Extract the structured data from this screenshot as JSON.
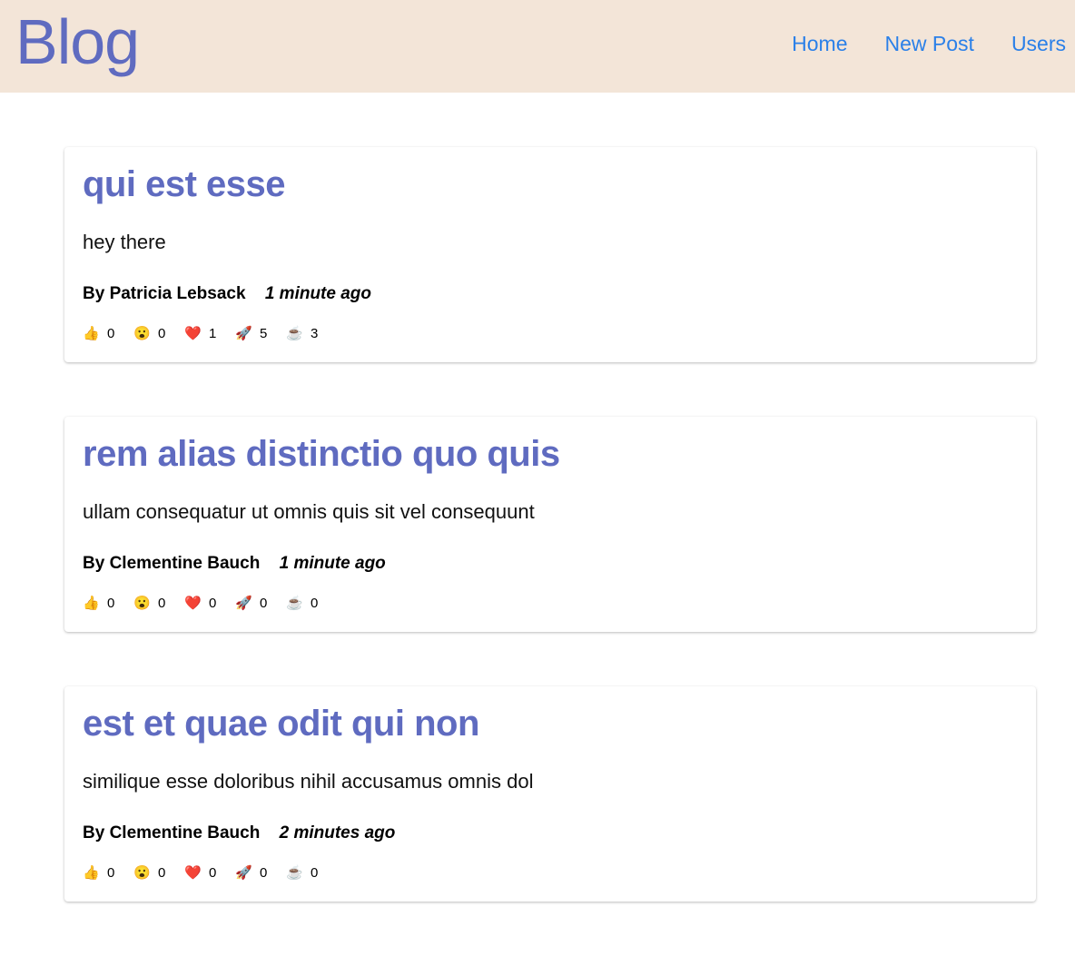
{
  "header": {
    "brand": "Blog",
    "nav": [
      {
        "label": "Home"
      },
      {
        "label": "New Post"
      },
      {
        "label": "Users"
      }
    ]
  },
  "posts": [
    {
      "title": "qui est esse",
      "body": "hey there",
      "author": "By Patricia Lebsack",
      "time": "1 minute ago",
      "reactions": [
        {
          "icon": "👍",
          "name": "thumbs-up-icon",
          "count": "0"
        },
        {
          "icon": "😮",
          "name": "surprised-face-icon",
          "count": "0"
        },
        {
          "icon": "❤️",
          "name": "heart-icon",
          "count": "1"
        },
        {
          "icon": "🚀",
          "name": "rocket-icon",
          "count": "5"
        },
        {
          "icon": "☕",
          "name": "coffee-icon",
          "count": "3"
        }
      ]
    },
    {
      "title": "rem alias distinctio quo quis",
      "body": "ullam consequatur ut omnis quis sit vel consequunt",
      "author": "By Clementine Bauch",
      "time": "1 minute ago",
      "reactions": [
        {
          "icon": "👍",
          "name": "thumbs-up-icon",
          "count": "0"
        },
        {
          "icon": "😮",
          "name": "surprised-face-icon",
          "count": "0"
        },
        {
          "icon": "❤️",
          "name": "heart-icon",
          "count": "0"
        },
        {
          "icon": "🚀",
          "name": "rocket-icon",
          "count": "0"
        },
        {
          "icon": "☕",
          "name": "coffee-icon",
          "count": "0"
        }
      ]
    },
    {
      "title": "est et quae odit qui non",
      "body": "similique esse doloribus nihil accusamus omnis dol",
      "author": "By Clementine Bauch",
      "time": "2 minutes ago",
      "reactions": [
        {
          "icon": "👍",
          "name": "thumbs-up-icon",
          "count": "0"
        },
        {
          "icon": "😮",
          "name": "surprised-face-icon",
          "count": "0"
        },
        {
          "icon": "❤️",
          "name": "heart-icon",
          "count": "0"
        },
        {
          "icon": "🚀",
          "name": "rocket-icon",
          "count": "0"
        },
        {
          "icon": "☕",
          "name": "coffee-icon",
          "count": "0"
        }
      ]
    }
  ]
}
